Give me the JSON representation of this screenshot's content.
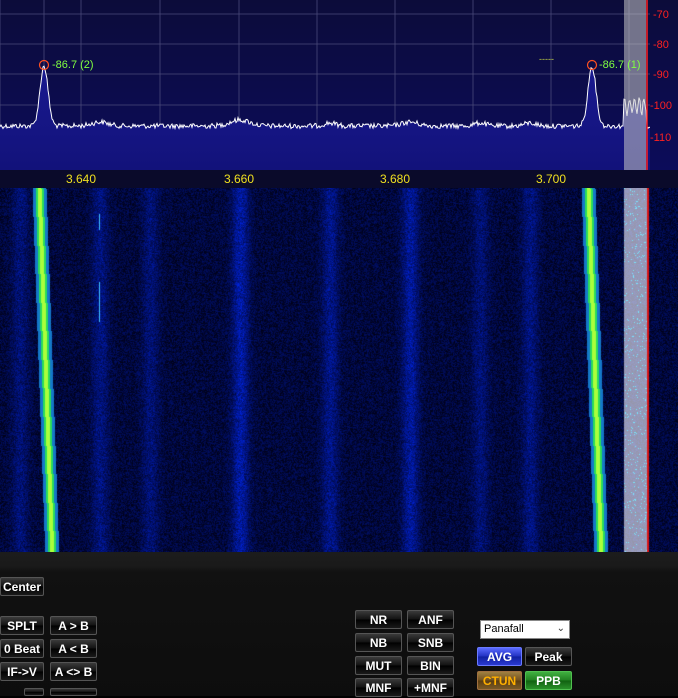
{
  "spectrum": {
    "db_scale": [
      "-70",
      "-80",
      "-90",
      "-100",
      "-110"
    ],
    "freq_labels": [
      "3.640",
      "3.660",
      "3.680",
      "3.700"
    ],
    "peak_markers": [
      {
        "label": "-86.7 (2)"
      },
      {
        "label": "-86.7 (1)"
      }
    ],
    "dash_marker": "-----"
  },
  "controls": {
    "center_label": "Center",
    "splt_label": "SPLT",
    "a_to_b_label": "A > B",
    "zero_beat_label": "0 Beat",
    "b_to_a_label": "A < B",
    "if_v_label": "IF->V",
    "a_swap_b_label": "A <> B",
    "nr_label": "NR",
    "anf_label": "ANF",
    "nb_label": "NB",
    "snb_label": "SNB",
    "mut_label": "MUT",
    "bin_label": "BIN",
    "mnf_label": "MNF",
    "plus_mnf_label": "+MNF",
    "display_mode_value": "Panafall",
    "avg_label": "AVG",
    "peak_label": "Peak",
    "ctun_label": "CTUN",
    "ppb_label": "PPB"
  },
  "colors": {
    "spectrum_fill": "#10107a",
    "grid": "#5a5a8a",
    "db_label": "#ff2020",
    "freq_label": "#f0e020",
    "marker_label": "#80ff40",
    "signal_core": "#a0ff40"
  }
}
